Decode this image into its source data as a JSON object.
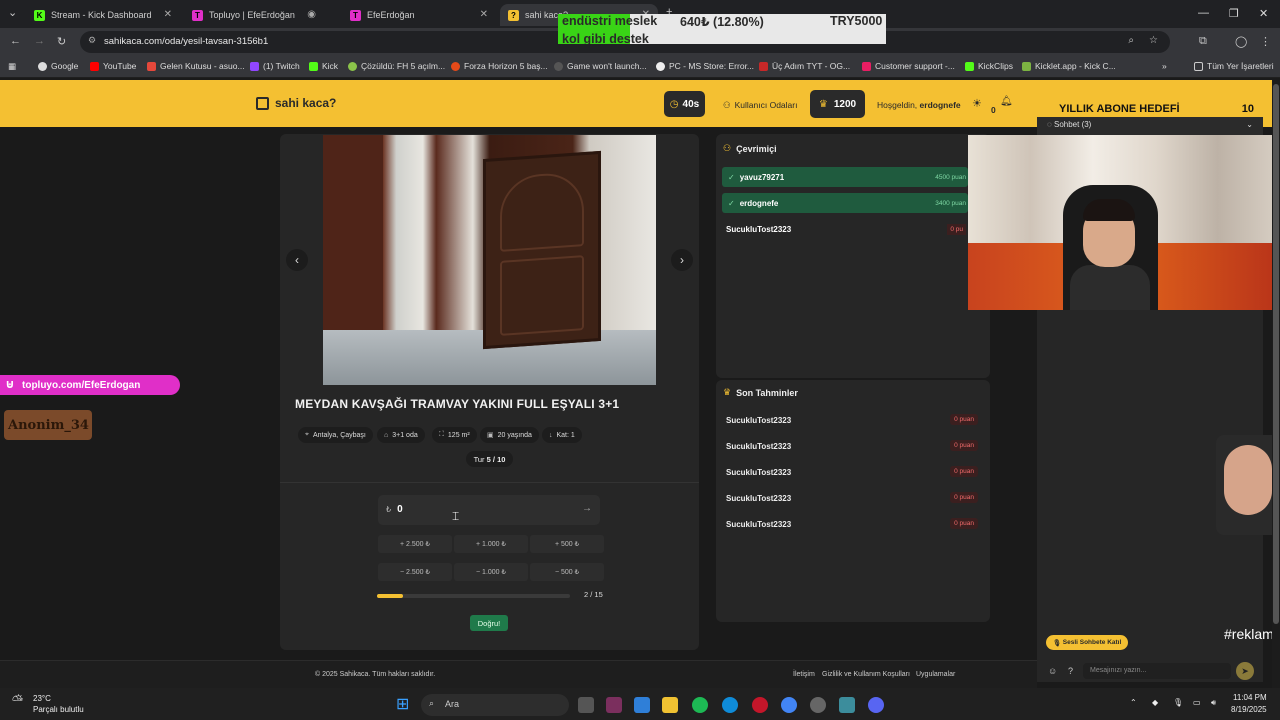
{
  "browser": {
    "tabs": [
      {
        "label": "Stream - Kick Dashboard",
        "color": "#53fc18"
      },
      {
        "label": "Topluyo | EfeErdoğan",
        "color": "#e02fc8"
      },
      {
        "label": "EfeErdoğan",
        "color": "#e02fc8"
      },
      {
        "label": "sahi kaca?",
        "color": "#f4c032"
      }
    ],
    "url": "sahikaca.com/oda/yesil-tavsan-3156b1",
    "bookmarks": [
      "Google",
      "YouTube",
      "Gelen Kutusu - asuo...",
      "(1) Twitch",
      "Kick",
      "Çözüldü: FH 5 açılm...",
      "Forza Horizon 5 baş...",
      "Game won't launch...",
      "PC - MS Store: Error...",
      "Üç Adım TYT - OG...",
      "Customer support -...",
      "KickClips",
      "Kicklet.app - Kick C..."
    ],
    "all_bookmarks": "Tüm Yer İşaretleri"
  },
  "overlay_top": {
    "line1_a": "endüstri meslek",
    "line1_b": "640₺ (12.80%)",
    "line1_c": "TRY5000",
    "line2": "kol gibi destek"
  },
  "header": {
    "logo": "sahi kaca?",
    "timer": "40s",
    "rooms": "Kullanıcı Odaları",
    "score": "1200",
    "welcome_prefix": "Hoşgeldin,",
    "username": "erdognefe",
    "notif_count": "0"
  },
  "listing": {
    "title": "MEYDAN KAVŞAĞI TRAMVAY YAKINI FULL EŞYALI 3+1",
    "chips": [
      {
        "icon": "⌖",
        "label": "Antalya, Çaybaşı"
      },
      {
        "icon": "⌂",
        "label": "3+1 oda"
      },
      {
        "icon": "⛶",
        "label": "125 m²"
      },
      {
        "icon": "▣",
        "label": "20 yaşında"
      },
      {
        "icon": "↓",
        "label": "Kat: 1"
      }
    ],
    "round_label": "Tur",
    "round": "5 / 10",
    "currency": "₺",
    "guess_value": "0",
    "plus_buttons": [
      "+ 2.500 ₺",
      "+ 1.000 ₺",
      "+ 500 ₺"
    ],
    "minus_buttons": [
      "− 2.500 ₺",
      "− 1.000 ₺",
      "− 500 ₺"
    ],
    "progress_label": "2 / 15",
    "progress_fraction": 0.133,
    "submit": "Doğru!"
  },
  "online": {
    "title": "Çevrimiçi",
    "users": [
      {
        "name": "yavuz79271",
        "points": "4500 puan",
        "active": true
      },
      {
        "name": "erdognefe",
        "points": "3400 puan",
        "active": true
      },
      {
        "name": "SucukluTost2323",
        "points": "0 pu",
        "active": false
      }
    ]
  },
  "guesses": {
    "title": "Son Tahminler",
    "rows": [
      {
        "name": "SucukluTost2323",
        "points": "0 puan"
      },
      {
        "name": "SucukluTost2323",
        "points": "0 puan"
      },
      {
        "name": "SucukluTost2323",
        "points": "0 puan"
      },
      {
        "name": "SucukluTost2323",
        "points": "0 puan"
      },
      {
        "name": "SucukluTost2323",
        "points": "0 puan"
      }
    ]
  },
  "stream_overlay": {
    "goal_label": "YILLIK ABONE HEDEFİ",
    "goal_value": "10",
    "chat_title": "Sohbet (3)",
    "topluyo": "topluyo.com/EfeErdogan",
    "anonim": "Anonim_34",
    "reklam": "#reklam",
    "slow_mode": "Sesli Sohbete Katıl",
    "chat_placeholder": "Mesajınızı yazın..."
  },
  "footer": {
    "copyright": "© 2025 Sahikaca. Tüm hakları saklıdır.",
    "links": [
      "İletişim",
      "Gizlilik ve Kullanım Koşulları",
      "Uygulamalar"
    ]
  },
  "taskbar": {
    "temp": "23°C",
    "weather": "Parçalı bulutlu",
    "search": "Ara",
    "time": "11:04 PM",
    "date": "8/19/2025"
  }
}
